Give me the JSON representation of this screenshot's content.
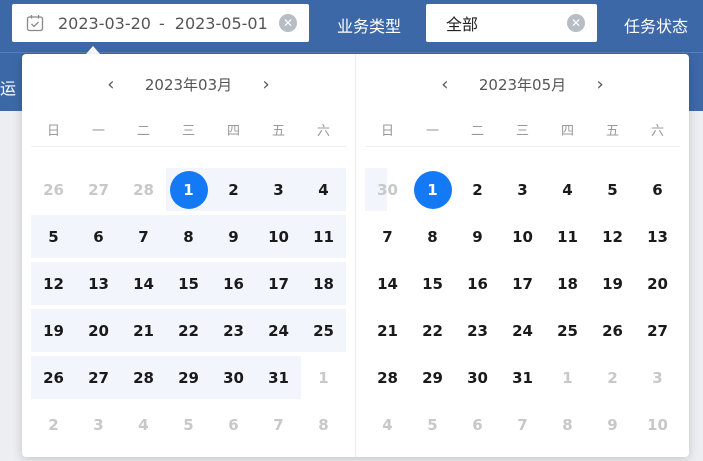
{
  "filters": {
    "date_start": "2023-03-20",
    "date_sep": "-",
    "date_end": "2023-05-01",
    "biz_type_label": "业务类型",
    "biz_type_value": "全部",
    "task_status_label": "任务状态",
    "left_cut_label": "运"
  },
  "icons": {
    "date": "calendar-icon",
    "clear": "clear-circle-icon",
    "prev": "chevron-left-icon",
    "next": "chevron-right-icon"
  },
  "colors": {
    "header_bg": "#3d68a8",
    "selected": "#1479f5",
    "range_bg": "#f2f5fb"
  },
  "weekdays": [
    "日",
    "一",
    "二",
    "三",
    "四",
    "五",
    "六"
  ],
  "months": [
    {
      "title": "2023年03月",
      "weeks": [
        [
          {
            "d": "26",
            "o": true
          },
          {
            "d": "27",
            "o": true
          },
          {
            "d": "28",
            "o": true
          },
          {
            "d": "1",
            "s": true,
            "r": true
          },
          {
            "d": "2",
            "r": true
          },
          {
            "d": "3",
            "r": true
          },
          {
            "d": "4",
            "r": true
          }
        ],
        [
          {
            "d": "5",
            "r": true
          },
          {
            "d": "6",
            "r": true
          },
          {
            "d": "7",
            "r": true
          },
          {
            "d": "8",
            "r": true
          },
          {
            "d": "9",
            "r": true
          },
          {
            "d": "10",
            "r": true
          },
          {
            "d": "11",
            "r": true
          }
        ],
        [
          {
            "d": "12",
            "r": true
          },
          {
            "d": "13",
            "r": true
          },
          {
            "d": "14",
            "r": true
          },
          {
            "d": "15",
            "r": true
          },
          {
            "d": "16",
            "r": true
          },
          {
            "d": "17",
            "r": true
          },
          {
            "d": "18",
            "r": true
          }
        ],
        [
          {
            "d": "19",
            "r": true
          },
          {
            "d": "20",
            "r": true
          },
          {
            "d": "21",
            "r": true
          },
          {
            "d": "22",
            "r": true
          },
          {
            "d": "23",
            "r": true
          },
          {
            "d": "24",
            "r": true
          },
          {
            "d": "25",
            "r": true
          }
        ],
        [
          {
            "d": "26",
            "r": true
          },
          {
            "d": "27",
            "r": true
          },
          {
            "d": "28",
            "r": true
          },
          {
            "d": "29",
            "r": true
          },
          {
            "d": "30",
            "r": true
          },
          {
            "d": "31",
            "r": true
          },
          {
            "d": "1",
            "o": true
          }
        ],
        [
          {
            "d": "2",
            "o": true
          },
          {
            "d": "3",
            "o": true
          },
          {
            "d": "4",
            "o": true
          },
          {
            "d": "5",
            "o": true
          },
          {
            "d": "6",
            "o": true
          },
          {
            "d": "7",
            "o": true
          },
          {
            "d": "8",
            "o": true
          }
        ]
      ]
    },
    {
      "title": "2023年05月",
      "weeks": [
        [
          {
            "d": "30",
            "o": true,
            "e": true
          },
          {
            "d": "1",
            "s": true
          },
          {
            "d": "2"
          },
          {
            "d": "3"
          },
          {
            "d": "4"
          },
          {
            "d": "5"
          },
          {
            "d": "6"
          }
        ],
        [
          {
            "d": "7"
          },
          {
            "d": "8"
          },
          {
            "d": "9"
          },
          {
            "d": "10"
          },
          {
            "d": "11"
          },
          {
            "d": "12"
          },
          {
            "d": "13"
          }
        ],
        [
          {
            "d": "14"
          },
          {
            "d": "15"
          },
          {
            "d": "16"
          },
          {
            "d": "17"
          },
          {
            "d": "18"
          },
          {
            "d": "19"
          },
          {
            "d": "20"
          }
        ],
        [
          {
            "d": "21"
          },
          {
            "d": "22"
          },
          {
            "d": "23"
          },
          {
            "d": "24"
          },
          {
            "d": "25"
          },
          {
            "d": "26"
          },
          {
            "d": "27"
          }
        ],
        [
          {
            "d": "28"
          },
          {
            "d": "29"
          },
          {
            "d": "30"
          },
          {
            "d": "31"
          },
          {
            "d": "1",
            "o": true
          },
          {
            "d": "2",
            "o": true
          },
          {
            "d": "3",
            "o": true
          }
        ],
        [
          {
            "d": "4",
            "o": true
          },
          {
            "d": "5",
            "o": true
          },
          {
            "d": "6",
            "o": true
          },
          {
            "d": "7",
            "o": true
          },
          {
            "d": "8",
            "o": true
          },
          {
            "d": "9",
            "o": true
          },
          {
            "d": "10",
            "o": true
          }
        ]
      ]
    }
  ]
}
